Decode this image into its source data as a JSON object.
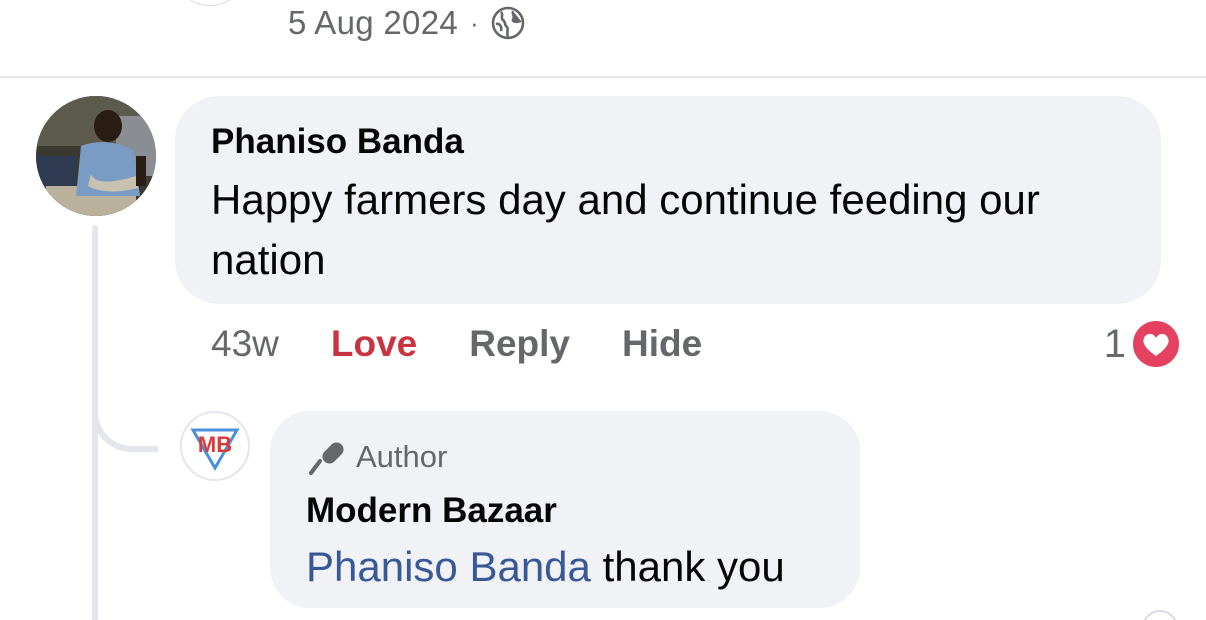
{
  "post": {
    "date": "5 Aug 2024",
    "separator": "·",
    "audience_icon": "globe-icon"
  },
  "comment": {
    "author": "Phaniso Banda",
    "text": "Happy farmers day and continue feeding our nation",
    "time": "43w",
    "actions": {
      "love": "Love",
      "reply": "Reply",
      "hide": "Hide"
    },
    "reaction": {
      "count": "1",
      "icon": "heart-icon",
      "color": "#e4405f"
    }
  },
  "reply": {
    "badge": "Author",
    "badge_icon": "microphone-icon",
    "author": "Modern Bazaar",
    "mention": "Phaniso Banda",
    "text": " thank you",
    "avatar_logo": "MB"
  },
  "colors": {
    "bubble": "#f0f2f5",
    "love": "#c73542",
    "mention": "#385898",
    "secondary_text": "#65676b"
  }
}
